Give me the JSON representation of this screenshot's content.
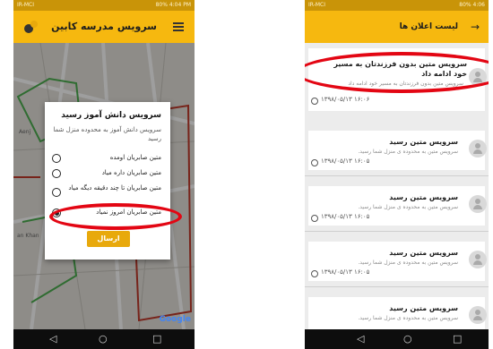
{
  "left": {
    "status": {
      "left": "IR-MCI",
      "right": "80% 4:04 PM"
    },
    "appbar": {
      "title": "سرویس مدرسه کابین"
    },
    "map": {
      "label_khan": "an Khan",
      "label_top": "Aenj",
      "google": "Google"
    },
    "dialog": {
      "title": "سرویس دانش آموز رسید",
      "message": "سرویس دانش آموز به محدوده منزل شما رسید",
      "options": [
        "متین صابریان اومده",
        "متین صابریان داره میاد",
        "متین صابریان تا چند دقیقه دیگه میاد",
        "متین صابریان امروز نمیاد"
      ],
      "selected_index": 3,
      "send_label": "ارسال"
    },
    "nav": {
      "back": "◁",
      "home": "○",
      "recents": "□"
    }
  },
  "right": {
    "status": {
      "left": "IR-MCI",
      "right": "80% 4:06"
    },
    "appbar": {
      "title": "لیست اعلان ها"
    },
    "cards": [
      {
        "title": "سرویس متین بدون فرزندتان به مسیر خود ادامه داد",
        "body": "سرویس متین بدون فرزندتان به مسیر خود ادامه داد",
        "time": "۱۳۹۸/۰۵/۱۳  ۱۶:۰۶"
      },
      {
        "title": "سرویس متین رسید",
        "body": "سرویس متین به محدوده ی منزل شما رسید.",
        "time": "۱۳۹۸/۰۵/۱۳  ۱۶:۰۵"
      },
      {
        "title": "سرویس متین رسید",
        "body": "سرویس متین به محدوده ی منزل شما رسید.",
        "time": "۱۳۹۸/۰۵/۱۳  ۱۶:۰۵"
      },
      {
        "title": "سرویس متین رسید",
        "body": "سرویس متین به محدوده ی منزل شما رسید.",
        "time": "۱۳۹۸/۰۵/۱۳  ۱۶:۰۵"
      },
      {
        "title": "سرویس متین رسید",
        "body": "سرویس متین به محدوده ی منزل شما رسید."
      }
    ],
    "nav": {
      "back": "◁",
      "home": "○",
      "recents": "□"
    }
  },
  "colors": {
    "accent": "#f6b80f",
    "highlight": "#e30613",
    "button": "#e8a90c"
  }
}
